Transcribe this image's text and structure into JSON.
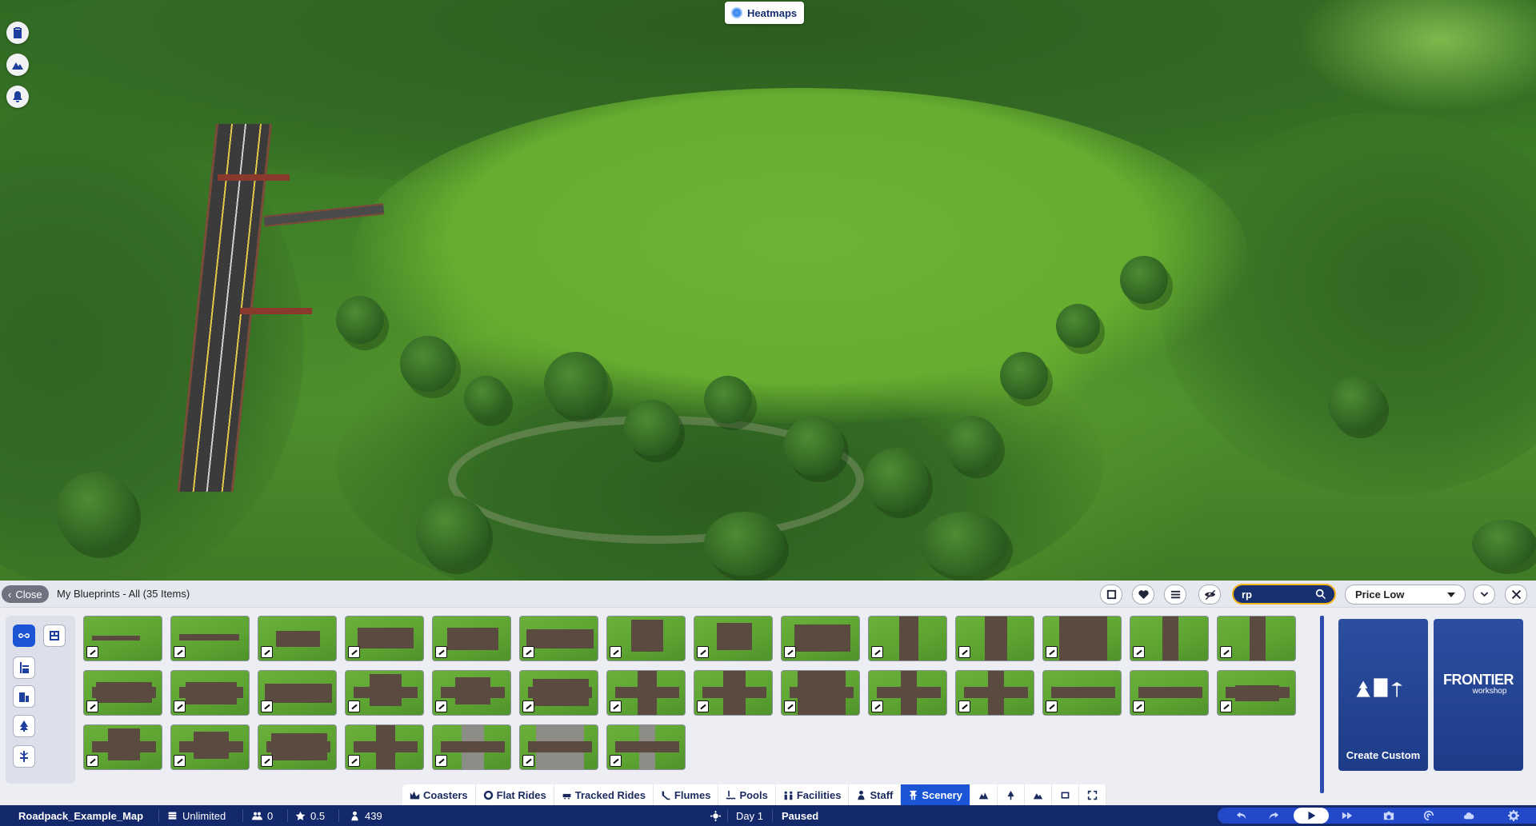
{
  "viewport": {
    "heatmaps_label": "Heatmaps",
    "side_buttons": [
      "clipboard-icon",
      "terrain-icon",
      "bell-icon"
    ]
  },
  "panel": {
    "close_label": "Close",
    "breadcrumb": "My Blueprints - All (35 Items)",
    "search": {
      "value": "rp"
    },
    "sort": {
      "selected": "Price Low"
    },
    "toolbar_icons": [
      "blueprint-toggle-icon",
      "heart-icon",
      "filter-sliders-icon",
      "eye-hidden-icon",
      "chevron-down-icon",
      "close-icon"
    ],
    "filters": [
      "infinity-icon",
      "blueprint-library-icon",
      "ride-builder-icon",
      "building-icon",
      "tree-icon",
      "path-icon"
    ],
    "item_count": 35,
    "create_custom_label": "Create Custom",
    "frontier": {
      "brand": "FRONTIER",
      "sub": "workshop"
    }
  },
  "tabs": [
    {
      "label": "Coasters",
      "icon": "coaster-icon"
    },
    {
      "label": "Flat Rides",
      "icon": "flat-ride-icon"
    },
    {
      "label": "Tracked Rides",
      "icon": "tracked-ride-icon"
    },
    {
      "label": "Flumes",
      "icon": "flume-icon"
    },
    {
      "label": "Pools",
      "icon": "pool-icon"
    },
    {
      "label": "Facilities",
      "icon": "facilities-icon"
    },
    {
      "label": "Staff",
      "icon": "staff-icon"
    },
    {
      "label": "Scenery",
      "icon": "scenery-icon",
      "active": true
    }
  ],
  "status": {
    "map_name": "Roadpack_Example_Map",
    "money": "Unlimited",
    "guests": "0",
    "rating": "0.5",
    "population": "439",
    "day": "Day 1",
    "state": "Paused"
  },
  "colors": {
    "accent": "#1c54d6",
    "statusbar": "#14296b",
    "search_border": "#f2b51c",
    "card": "#1d3c88"
  }
}
